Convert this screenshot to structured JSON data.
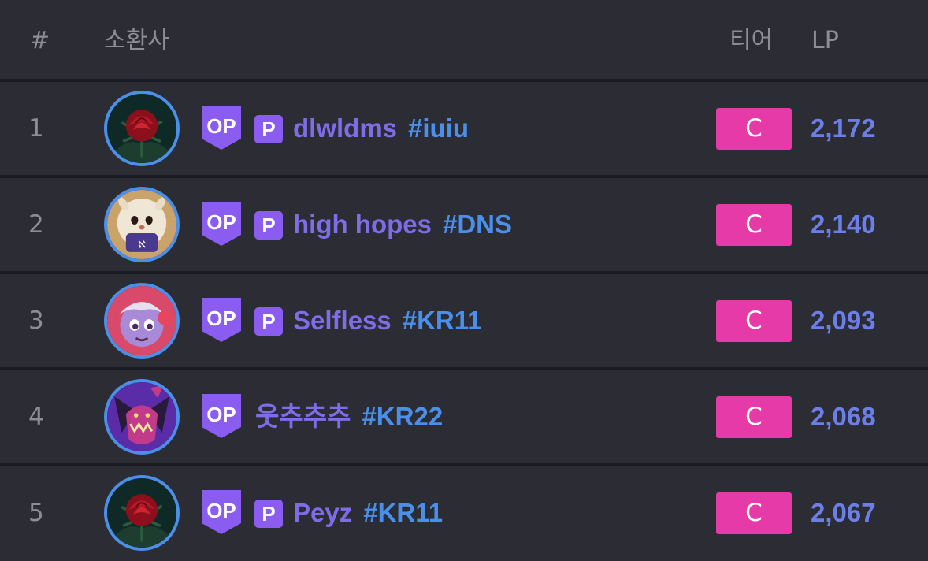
{
  "header": {
    "rank": "#",
    "summoner": "소환사",
    "tier": "티어",
    "lp": "LP"
  },
  "badge": {
    "op_label": "OP",
    "p_label": "P"
  },
  "rows": [
    {
      "rank": "1",
      "name": "dlwldms",
      "tag": "#iuiu",
      "has_p": true,
      "tier": "C",
      "lp": "2,172",
      "avatar": "rose-icon"
    },
    {
      "rank": "2",
      "name": "high hopes",
      "tag": "#DNS",
      "has_p": true,
      "tier": "C",
      "lp": "2,140",
      "avatar": "poro-icon"
    },
    {
      "rank": "3",
      "name": "Selfless",
      "tag": "#KR11",
      "has_p": true,
      "tier": "C",
      "lp": "2,093",
      "avatar": "tristana-icon"
    },
    {
      "rank": "4",
      "name": "웃추추추",
      "tag": "#KR22",
      "has_p": false,
      "tier": "C",
      "lp": "2,068",
      "avatar": "monster-icon"
    },
    {
      "rank": "5",
      "name": "Peyz",
      "tag": "#KR11",
      "has_p": true,
      "tier": "C",
      "lp": "2,067",
      "avatar": "rose-icon"
    }
  ],
  "colors": {
    "row_bg": "#2c2c35",
    "name_purple": "#7d6de6",
    "tag_blue": "#4a90ea",
    "tier_pink": "#e63aa8",
    "badge_purple": "#8b5cf0"
  }
}
